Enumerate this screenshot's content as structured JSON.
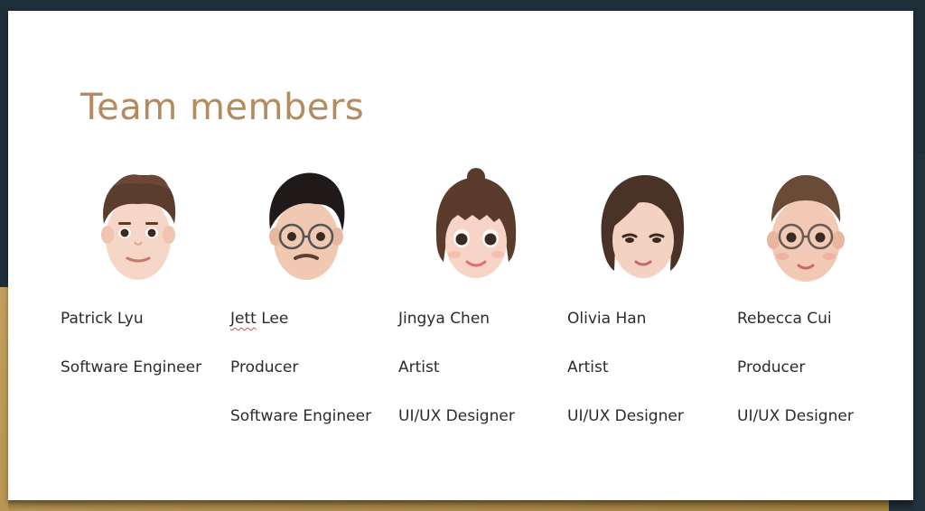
{
  "slide": {
    "title": "Team members"
  },
  "members": [
    {
      "name_first": "Patrick",
      "name_last": "Lyu",
      "roles": [
        "Software Engineer",
        ""
      ]
    },
    {
      "name_first": "Jett",
      "name_last": "Lee",
      "roles": [
        "Producer",
        "Software Engineer"
      ]
    },
    {
      "name_first": "Jingya",
      "name_last": "Chen",
      "roles": [
        "Artist",
        "UI/UX Designer"
      ]
    },
    {
      "name_first": "Olivia",
      "name_last": "Han",
      "roles": [
        "Artist",
        "UI/UX Designer"
      ]
    },
    {
      "name_first": "Rebecca",
      "name_last": "Cui",
      "roles": [
        "Producer",
        "UI/UX Designer"
      ]
    }
  ],
  "colors": {
    "title": "#b48a5f",
    "text": "#2b2b2b",
    "spellcheck": "#d94a4a"
  },
  "icons": [
    "avatar-patrick",
    "avatar-jett",
    "avatar-jingya",
    "avatar-olivia",
    "avatar-rebecca"
  ]
}
